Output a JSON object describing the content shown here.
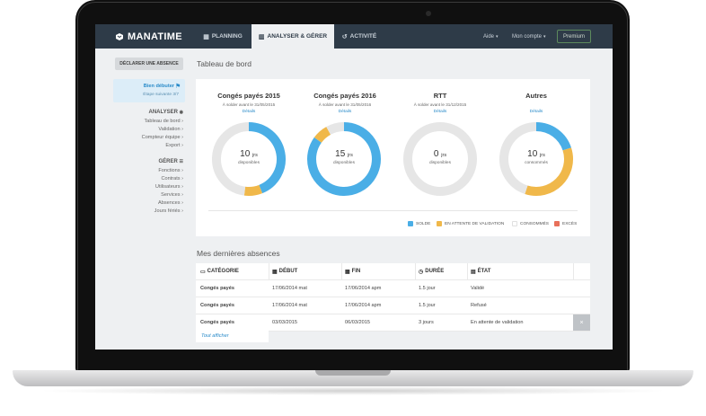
{
  "brand": {
    "name": "MANATIME"
  },
  "nav": {
    "tabs": [
      {
        "label": "PLANNING",
        "icon": "calendar-icon",
        "active": false
      },
      {
        "label": "ANALYSER & GÉRER",
        "icon": "bar-chart-icon",
        "active": true
      },
      {
        "label": "ACTIVITÉ",
        "icon": "history-icon",
        "active": false
      }
    ],
    "help": "Aide",
    "account": "Mon compte",
    "premium": "Premium"
  },
  "sidebar": {
    "declare_button": "DÉCLARER UNE ABSENCE",
    "welcome": {
      "title": "Bien débuter",
      "step": "Étape suivante 3/7"
    },
    "analyse_heading": "ANALYSER",
    "analyse_items": [
      "Tableau de bord ›",
      "Validation ›",
      "Compteur équipe ›",
      "Export ›"
    ],
    "manage_heading": "GÉRER",
    "manage_items": [
      "Fonctions ›",
      "Contrats ›",
      "Utilisateurs ›",
      "Services ›",
      "Absences ›",
      "Jours fériés ›"
    ]
  },
  "dashboard": {
    "title": "Tableau de bord",
    "details_label": "Détails",
    "stats": [
      {
        "title": "Congés payés 2015",
        "subtitle": "À solder avant le 31/05/2015",
        "value": "10",
        "unit": "jrs",
        "caption": "disponibles",
        "solde": 0.44,
        "attente": 0.08,
        "consommes": 0.48,
        "exces": 0
      },
      {
        "title": "Congés payés 2016",
        "subtitle": "À solder avant le 31/05/2016",
        "value": "15",
        "unit": "jrs",
        "caption": "disponibles",
        "solde": 0.85,
        "attente": 0.07,
        "consommes": 0.08,
        "exces": 0
      },
      {
        "title": "RTT",
        "subtitle": "À solder avant le 31/12/2015",
        "value": "0",
        "unit": "jrs",
        "caption": "disponibles",
        "solde": 0,
        "attente": 0,
        "consommes": 1.0,
        "exces": 0
      },
      {
        "title": "Autres",
        "subtitle": "",
        "value": "10",
        "unit": "jrs",
        "caption": "consommés",
        "solde": 0.2,
        "attente": 0.35,
        "consommes": 0.45,
        "exces": 0
      }
    ],
    "legend": [
      {
        "label": "SOLDE",
        "color": "#4aaee6"
      },
      {
        "label": "EN ATTENTE DE VALIDATION",
        "color": "#f0b84a"
      },
      {
        "label": "CONSOMMÉS",
        "color": "#e6e6e6"
      },
      {
        "label": "EXCÈS",
        "color": "#e8705a"
      }
    ]
  },
  "absences": {
    "title": "Mes dernières absences",
    "columns": [
      {
        "label": "CATÉGORIE",
        "icon": "folder-icon"
      },
      {
        "label": "DÉBUT",
        "icon": "calendar-icon"
      },
      {
        "label": "FIN",
        "icon": "calendar-icon"
      },
      {
        "label": "DURÉE",
        "icon": "clock-icon"
      },
      {
        "label": "ÉTAT",
        "icon": "document-icon"
      }
    ],
    "rows": [
      [
        "Congés payés",
        "17/06/2014 mat",
        "17/06/2014 apm",
        "1.5 jour",
        "Validé"
      ],
      [
        "Congés payés",
        "17/06/2014 mat",
        "17/06/2014 apm",
        "1.5 jour",
        "Refusé"
      ],
      [
        "Congés payés",
        "03/03/2015",
        "06/03/2015",
        "3 jours",
        "En attente de validation"
      ]
    ],
    "cancel_label": "×",
    "show_all": "Tout afficher"
  }
}
